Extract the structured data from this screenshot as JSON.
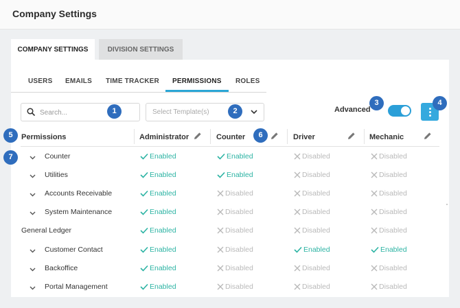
{
  "header": {
    "title": "Company Settings"
  },
  "outer_tabs": [
    {
      "label": "COMPANY SETTINGS",
      "active": true
    },
    {
      "label": "DIVISION SETTINGS",
      "active": false
    }
  ],
  "inner_tabs": [
    {
      "label": "USERS"
    },
    {
      "label": "EMAILS"
    },
    {
      "label": "TIME TRACKER"
    },
    {
      "label": "PERMISSIONS",
      "active": true
    },
    {
      "label": "ROLES"
    }
  ],
  "toolbar": {
    "search_placeholder": "Search...",
    "template_placeholder": "Select Template(s)",
    "advanced_label": "Advanced",
    "advanced_on": true
  },
  "badges": [
    "1",
    "2",
    "3",
    "4",
    "5",
    "6",
    "7"
  ],
  "table": {
    "columns": [
      "Permissions",
      "Administrator",
      "Counter",
      "Driver",
      "Mechanic"
    ],
    "enabled_label": "Enabled",
    "disabled_label": "Disabled",
    "rows": [
      {
        "label": "Counter",
        "expandable": true,
        "values": [
          "Enabled",
          "Enabled",
          "Disabled",
          "Disabled"
        ]
      },
      {
        "label": "Utilities",
        "expandable": true,
        "values": [
          "Enabled",
          "Enabled",
          "Disabled",
          "Disabled"
        ]
      },
      {
        "label": "Accounts Receivable",
        "expandable": true,
        "values": [
          "Enabled",
          "Disabled",
          "Disabled",
          "Disabled"
        ]
      },
      {
        "label": "System Maintenance",
        "expandable": true,
        "values": [
          "Enabled",
          "Disabled",
          "Disabled",
          "Disabled"
        ]
      },
      {
        "label": "General Ledger",
        "expandable": false,
        "values": [
          "Enabled",
          "Disabled",
          "Disabled",
          "Disabled"
        ]
      },
      {
        "label": "Customer Contact",
        "expandable": true,
        "values": [
          "Enabled",
          "Disabled",
          "Enabled",
          "Enabled"
        ]
      },
      {
        "label": "Backoffice",
        "expandable": true,
        "values": [
          "Enabled",
          "Disabled",
          "Disabled",
          "Disabled"
        ]
      },
      {
        "label": "Portal Management",
        "expandable": true,
        "values": [
          "Enabled",
          "Disabled",
          "Disabled",
          "Disabled"
        ]
      }
    ]
  },
  "colors": {
    "accent": "#2aa6d6",
    "badge": "#2f6dbd",
    "enabled": "#2bb3a3",
    "disabled": "#b9b9b9"
  },
  "icons": {
    "search": "search-icon",
    "chevron": "chevron-down-icon",
    "kebab": "more-vertical-icon",
    "edit": "pencil-icon",
    "check": "check-icon",
    "cross": "x-icon"
  }
}
